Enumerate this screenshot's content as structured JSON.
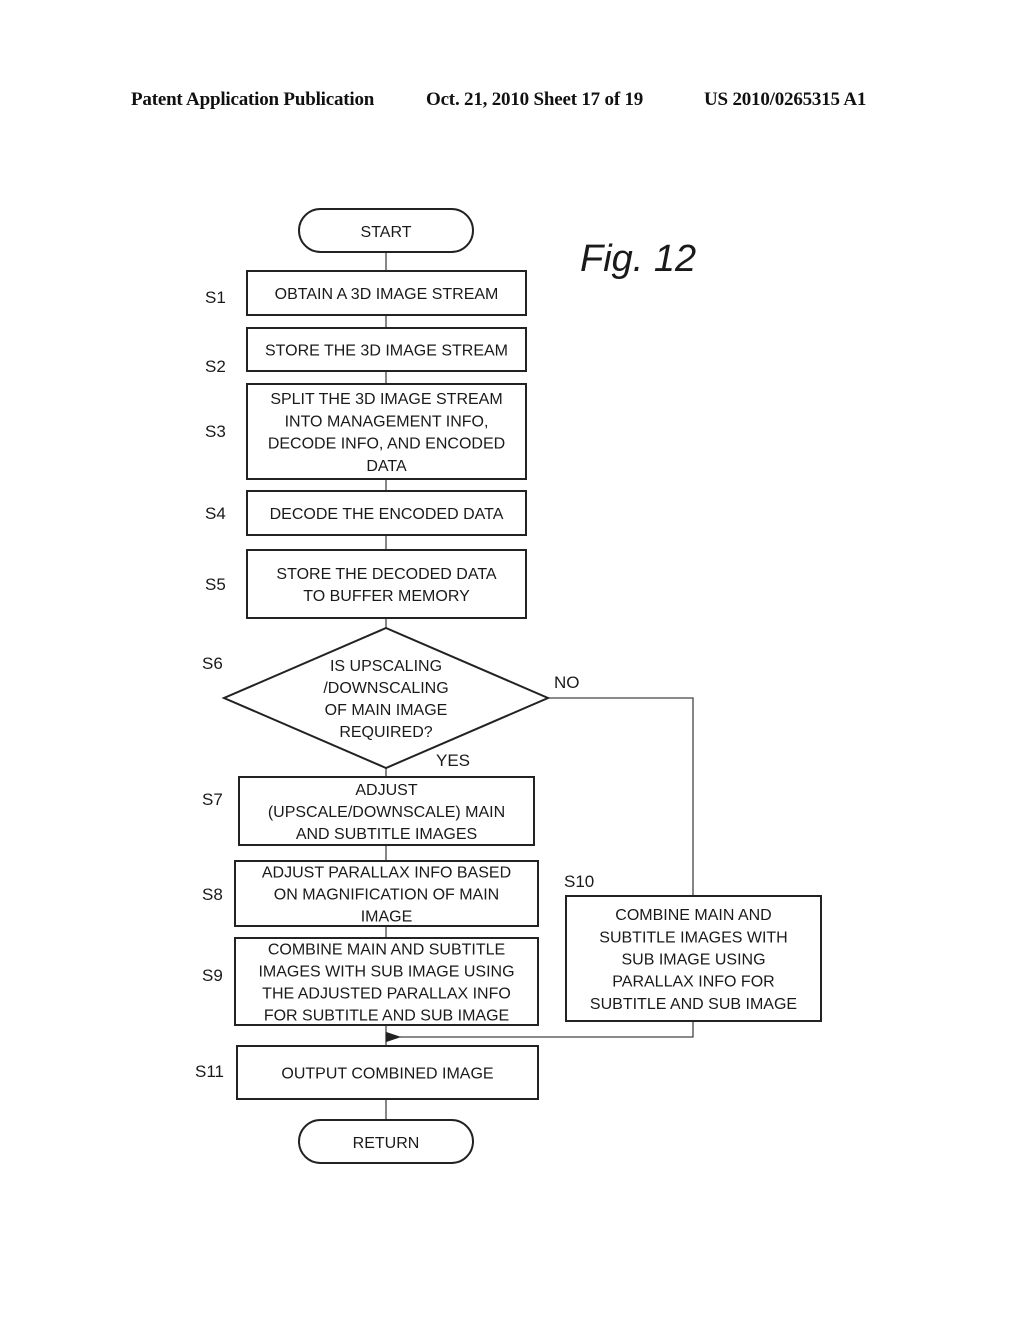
{
  "header": {
    "publication": "Patent Application Publication",
    "date_sheet": "Oct. 21, 2010   Sheet 17 of 19",
    "number": "US 2010/0265315 A1"
  },
  "figure_label": "Fig. 12",
  "flow": {
    "start": "START",
    "end": "RETURN",
    "steps": [
      {
        "id": "S1",
        "lines": [
          "OBTAIN A 3D IMAGE STREAM"
        ]
      },
      {
        "id": "S2",
        "lines": [
          "STORE THE 3D IMAGE STREAM"
        ]
      },
      {
        "id": "S3",
        "lines": [
          "SPLIT THE 3D IMAGE STREAM",
          "INTO MANAGEMENT INFO,",
          "DECODE INFO, AND ENCODED",
          "DATA"
        ]
      },
      {
        "id": "S4",
        "lines": [
          "DECODE THE ENCODED DATA"
        ]
      },
      {
        "id": "S5",
        "lines": [
          "STORE THE DECODED DATA",
          "TO BUFFER MEMORY"
        ]
      },
      {
        "id": "S6",
        "lines": [
          "IS UPSCALING",
          "/DOWNSCALING",
          "OF MAIN IMAGE",
          "REQUIRED?"
        ],
        "yes": "YES",
        "no": "NO"
      },
      {
        "id": "S7",
        "lines": [
          "ADJUST",
          "(UPSCALE/DOWNSCALE) MAIN",
          "AND SUBTITLE IMAGES"
        ]
      },
      {
        "id": "S8",
        "lines": [
          "ADJUST PARALLAX INFO BASED",
          "ON MAGNIFICATION OF MAIN",
          "IMAGE"
        ]
      },
      {
        "id": "S9",
        "lines": [
          "COMBINE MAIN AND SUBTITLE",
          "IMAGES WITH SUB IMAGE USING",
          "THE ADJUSTED PARALLAX INFO",
          "FOR SUBTITLE AND SUB IMAGE"
        ]
      },
      {
        "id": "S10",
        "lines": [
          "COMBINE MAIN AND",
          "SUBTITLE IMAGES WITH",
          "SUB IMAGE USING",
          "PARALLAX INFO FOR",
          "SUBTITLE AND SUB IMAGE"
        ]
      },
      {
        "id": "S11",
        "lines": [
          "OUTPUT COMBINED IMAGE"
        ]
      }
    ]
  }
}
